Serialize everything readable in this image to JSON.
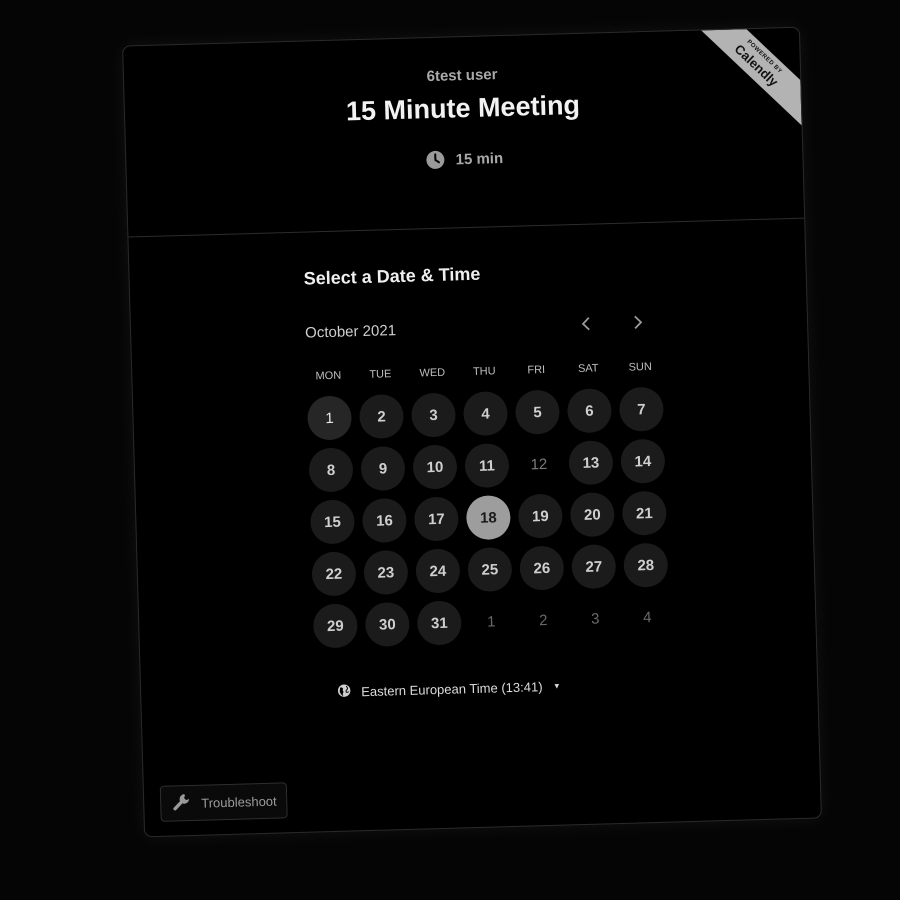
{
  "header": {
    "organizer": "6test user",
    "title": "15 Minute Meeting",
    "duration": "15 min",
    "badge_small": "POWERED BY",
    "badge_brand": "Calendly"
  },
  "scheduler": {
    "section_title": "Select a Date & Time",
    "month_label": "October 2021",
    "prev_icon": "chevron-left-icon",
    "next_icon": "chevron-right-icon",
    "weekdays": [
      "MON",
      "TUE",
      "WED",
      "THU",
      "FRI",
      "SAT",
      "SUN"
    ],
    "days": [
      {
        "label": "1",
        "state": "today"
      },
      {
        "label": "2",
        "state": "available"
      },
      {
        "label": "3",
        "state": "available"
      },
      {
        "label": "4",
        "state": "available"
      },
      {
        "label": "5",
        "state": "available"
      },
      {
        "label": "6",
        "state": "available"
      },
      {
        "label": "7",
        "state": "available"
      },
      {
        "label": "8",
        "state": "available"
      },
      {
        "label": "9",
        "state": "available"
      },
      {
        "label": "10",
        "state": "available"
      },
      {
        "label": "11",
        "state": "available"
      },
      {
        "label": "12",
        "state": "unavailable"
      },
      {
        "label": "13",
        "state": "available"
      },
      {
        "label": "14",
        "state": "available"
      },
      {
        "label": "15",
        "state": "available"
      },
      {
        "label": "16",
        "state": "available"
      },
      {
        "label": "17",
        "state": "available"
      },
      {
        "label": "18",
        "state": "selected"
      },
      {
        "label": "19",
        "state": "available"
      },
      {
        "label": "20",
        "state": "available"
      },
      {
        "label": "21",
        "state": "available"
      },
      {
        "label": "22",
        "state": "available"
      },
      {
        "label": "23",
        "state": "available"
      },
      {
        "label": "24",
        "state": "available"
      },
      {
        "label": "25",
        "state": "available"
      },
      {
        "label": "26",
        "state": "available"
      },
      {
        "label": "27",
        "state": "available"
      },
      {
        "label": "28",
        "state": "available"
      },
      {
        "label": "29",
        "state": "available"
      },
      {
        "label": "30",
        "state": "available"
      },
      {
        "label": "31",
        "state": "available"
      },
      {
        "label": "1",
        "state": "other"
      },
      {
        "label": "2",
        "state": "other"
      },
      {
        "label": "3",
        "state": "other"
      },
      {
        "label": "4",
        "state": "other"
      }
    ],
    "timezone_label": "Eastern European Time (13:41)"
  },
  "footer": {
    "troubleshoot_label": "Troubleshoot"
  },
  "colors": {
    "background": "#000000",
    "selected_day": "#9d9d9d",
    "available_day": "#1b1b1b",
    "ribbon": "#b3b3b3"
  }
}
